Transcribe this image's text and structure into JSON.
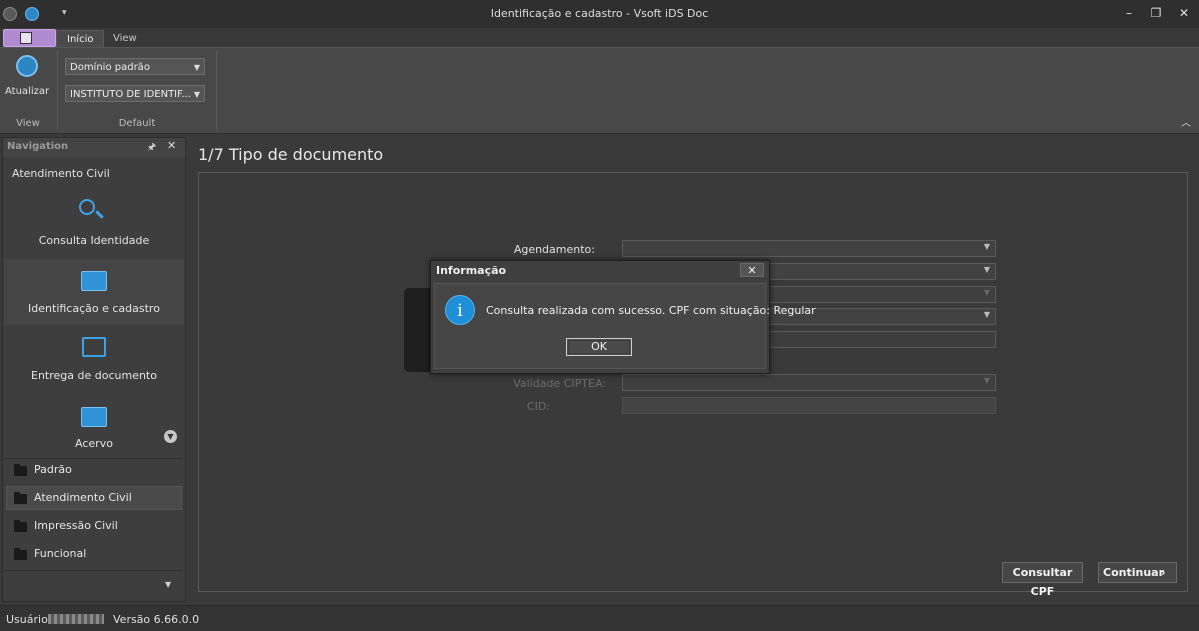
{
  "window": {
    "title": "Identificação e cadastro - Vsoft iDS Doc"
  },
  "ribbon": {
    "tabs": [
      {
        "label": "Início"
      },
      {
        "label": "View"
      }
    ],
    "refresh_label": "Atualizar",
    "group_view_label": "View",
    "group_default_label": "Default",
    "domain_combo": "Domínio padrão",
    "institute_combo": "INSTITUTO DE IDENTIF..."
  },
  "navigation": {
    "header": "Navigation",
    "section_title": "Atendimento Civil",
    "items": [
      {
        "label": "Consulta Identidade",
        "icon": "search-icon"
      },
      {
        "label": "Identificação e cadastro",
        "icon": "id-card-icon"
      },
      {
        "label": "Entrega de documento",
        "icon": "hand-card-icon"
      },
      {
        "label": "Acervo",
        "icon": "id-card-icon"
      }
    ],
    "groups": [
      {
        "label": "Padrão"
      },
      {
        "label": "Atendimento Civil"
      },
      {
        "label": "Impressão Civil"
      },
      {
        "label": "Funcional"
      }
    ]
  },
  "main": {
    "title": "1/7 Tipo de documento",
    "fields": {
      "agendamento_label": "Agendamento:",
      "validade_label": "Validade CIPTEA:",
      "cid_label": "CID:"
    },
    "buttons": {
      "consultar_cpf": "Consultar CPF",
      "continuar": "Continuar"
    }
  },
  "dialog": {
    "title": "Informação",
    "message": "Consulta realizada com sucesso. CPF com situação: Regular",
    "ok_label": "OK",
    "close_label": "✕"
  },
  "status": {
    "user_label": "Usuário:",
    "version_label": "Versão 6.66.0.0"
  },
  "colors": {
    "accent_blue": "#1f8fd8",
    "app_button": "#b08bd0",
    "background": "#3a3a3a"
  }
}
